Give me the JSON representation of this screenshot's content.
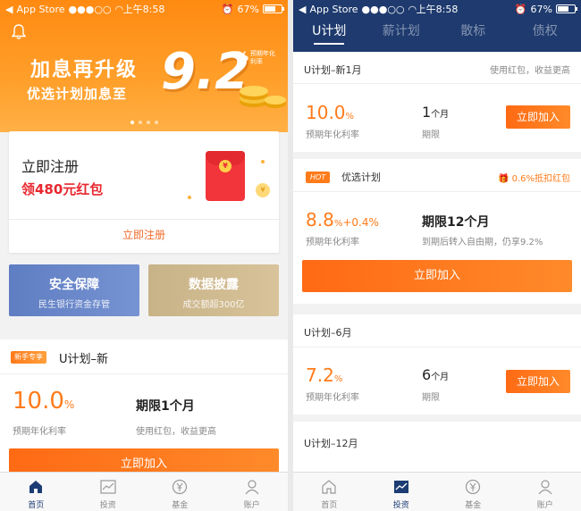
{
  "status_bar": {
    "carrier": "App Store",
    "time": "上午8:58",
    "battery": "67%",
    "battery_level": 0.67
  },
  "colors": {
    "accent": "#ff7b1a",
    "nav": "#1e3a6e",
    "red": "#e8272e"
  },
  "left": {
    "banner": {
      "title": "加息再升级",
      "subtitle": "优选计划加息至",
      "rate": "9.2",
      "pct": "%",
      "note": "预期年化利率"
    },
    "register": {
      "title": "立即注册",
      "subtitle": "领480元红包",
      "link": "立即注册",
      "envelope_symbol": "¥"
    },
    "tiles": [
      {
        "title": "安全保障",
        "sub": "民生银行资金存管"
      },
      {
        "title": "数据披露",
        "sub": "成交额超300亿"
      }
    ],
    "plan_new": {
      "badge": "新手专享",
      "title": "U计划–新",
      "rate": "10.0",
      "rate_unit": "%",
      "rate_label": "预期年化利率",
      "term": "期限1个月",
      "term_label": "使用红包，收益更高",
      "button": "立即加入"
    },
    "tabs": [
      {
        "label": "首页",
        "icon": "home-icon",
        "active": true
      },
      {
        "label": "投资",
        "icon": "chart-icon",
        "active": false
      },
      {
        "label": "基金",
        "icon": "yen-icon",
        "active": false
      },
      {
        "label": "账户",
        "icon": "user-icon",
        "active": false
      }
    ]
  },
  "right": {
    "nav_tabs": [
      {
        "label": "U计划",
        "active": true
      },
      {
        "label": "薪计划",
        "active": false
      },
      {
        "label": "散标",
        "active": false
      },
      {
        "label": "债权",
        "active": false
      }
    ],
    "cards": [
      {
        "title": "U计划–新1月",
        "note": "使用红包，收益更高",
        "rate": "10.0",
        "rate_unit": "%",
        "rate_label": "预期年化利率",
        "term_num": "1",
        "term_unit": "个月",
        "term_label": "期限",
        "button": "立即加入"
      },
      {
        "hot": "HOT",
        "title": "优选计划",
        "gift": "0.6%抵扣红包",
        "rate": "8.8",
        "rate_unit": "%",
        "rate_extra": "+0.4%",
        "rate_label": "预期年化利率",
        "term": "期限12个月",
        "term_label": "到期后转入自由期，仍享9.2%",
        "button": "立即加入"
      },
      {
        "title": "U计划–6月",
        "rate": "7.2",
        "rate_unit": "%",
        "rate_label": "预期年化利率",
        "term_num": "6",
        "term_unit": "个月",
        "term_label": "期限",
        "button": "立即加入"
      },
      {
        "title": "U计划–12月"
      }
    ],
    "tabs": [
      {
        "label": "首页",
        "icon": "home-icon",
        "active": false
      },
      {
        "label": "投资",
        "icon": "chart-icon",
        "active": true
      },
      {
        "label": "基金",
        "icon": "yen-icon",
        "active": false
      },
      {
        "label": "账户",
        "icon": "user-icon",
        "active": false
      }
    ]
  }
}
